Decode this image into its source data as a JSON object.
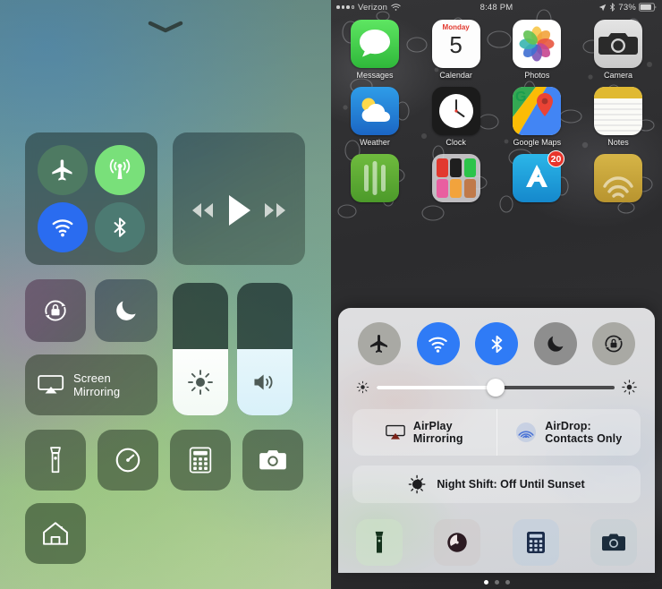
{
  "left_panel": {
    "name": "iOS 11 Control Center",
    "grabber": "chevron-down-handle",
    "connectivity": {
      "airplane_mode": {
        "label": "Airplane Mode",
        "state": "off",
        "color": "#4e7a62"
      },
      "cellular_data": {
        "label": "Cellular Data",
        "state": "on",
        "color": "#79e07a"
      },
      "wifi": {
        "label": "Wi-Fi",
        "state": "on",
        "color": "#2a6cf0"
      },
      "bluetooth": {
        "label": "Bluetooth",
        "state": "off",
        "color": "#4c7a72"
      }
    },
    "media": {
      "rewind": "Rewind",
      "play": "Play",
      "fast_forward": "Fast Forward"
    },
    "rotation_lock": {
      "label": "Portrait Orientation Lock",
      "state": "off"
    },
    "do_not_disturb": {
      "label": "Do Not Disturb",
      "state": "off"
    },
    "screen_mirroring": {
      "line1": "Screen",
      "line2": "Mirroring"
    },
    "brightness_slider": {
      "label": "Brightness",
      "value": 50
    },
    "volume_slider": {
      "label": "Volume",
      "value": 50
    },
    "shortcuts": [
      {
        "name": "flashlight",
        "label": "Flashlight"
      },
      {
        "name": "timer",
        "label": "Timer"
      },
      {
        "name": "calculator",
        "label": "Calculator"
      },
      {
        "name": "camera",
        "label": "Camera"
      },
      {
        "name": "home",
        "label": "Home"
      }
    ]
  },
  "right_panel": {
    "name": "iOS 10 Control Center",
    "status_bar": {
      "signal_dots": "3 filled, 1 hollow",
      "carrier": "Verizon",
      "wifi": "wifi-icon",
      "time": "8:48 PM",
      "location": "location-arrow-icon",
      "bluetooth": "bluetooth-icon",
      "battery_percent": "73%"
    },
    "home_screen": {
      "rows": [
        [
          {
            "label": "Messages",
            "icon": "messages-icon",
            "badge": null
          },
          {
            "label": "Calendar",
            "icon": "calendar-icon",
            "weekday": "Monday",
            "day": "5",
            "badge": null
          },
          {
            "label": "Photos",
            "icon": "photos-icon",
            "badge": null
          },
          {
            "label": "Camera",
            "icon": "camera-icon",
            "badge": null
          }
        ],
        [
          {
            "label": "Weather",
            "icon": "weather-icon",
            "badge": null
          },
          {
            "label": "Clock",
            "icon": "clock-icon",
            "badge": null
          },
          {
            "label": "Google Maps",
            "icon": "google-maps-icon",
            "badge": null
          },
          {
            "label": "Notes",
            "icon": "notes-icon",
            "badge": null
          }
        ],
        [
          {
            "label": "",
            "icon": "podcasts-icon",
            "badge": null
          },
          {
            "label": "",
            "icon": "folder-icon",
            "badge": null
          },
          {
            "label": "",
            "icon": "app-store-icon",
            "badge": "20"
          },
          {
            "label": "",
            "icon": "itunes-icon",
            "badge": null
          }
        ]
      ]
    },
    "control_center": {
      "toggles": [
        {
          "name": "airplane-mode",
          "label": "Airplane Mode",
          "state": "off",
          "color": "#a9a9a4"
        },
        {
          "name": "wifi",
          "label": "Wi-Fi",
          "state": "on",
          "color": "#2f7bf6"
        },
        {
          "name": "bluetooth",
          "label": "Bluetooth",
          "state": "on",
          "color": "#2f7bf6"
        },
        {
          "name": "do-not-disturb",
          "label": "Do Not Disturb",
          "state": "off",
          "color": "#8e8e8e"
        },
        {
          "name": "rotation-lock",
          "label": "Rotation Lock",
          "state": "off",
          "color": "#a9a9a4"
        }
      ],
      "brightness": {
        "label": "Brightness",
        "value": 50
      },
      "airplay": {
        "line1": "AirPlay",
        "line2": "Mirroring"
      },
      "airdrop": {
        "line1": "AirDrop:",
        "line2": "Contacts Only"
      },
      "night_shift": {
        "label": "Night Shift: Off Until Sunset"
      },
      "shortcuts": [
        {
          "name": "flashlight",
          "label": "Flashlight"
        },
        {
          "name": "timer",
          "label": "Timer"
        },
        {
          "name": "calculator",
          "label": "Calculator"
        },
        {
          "name": "camera",
          "label": "Camera"
        }
      ],
      "page_dots": {
        "count": 3,
        "active_index": 0
      }
    }
  }
}
